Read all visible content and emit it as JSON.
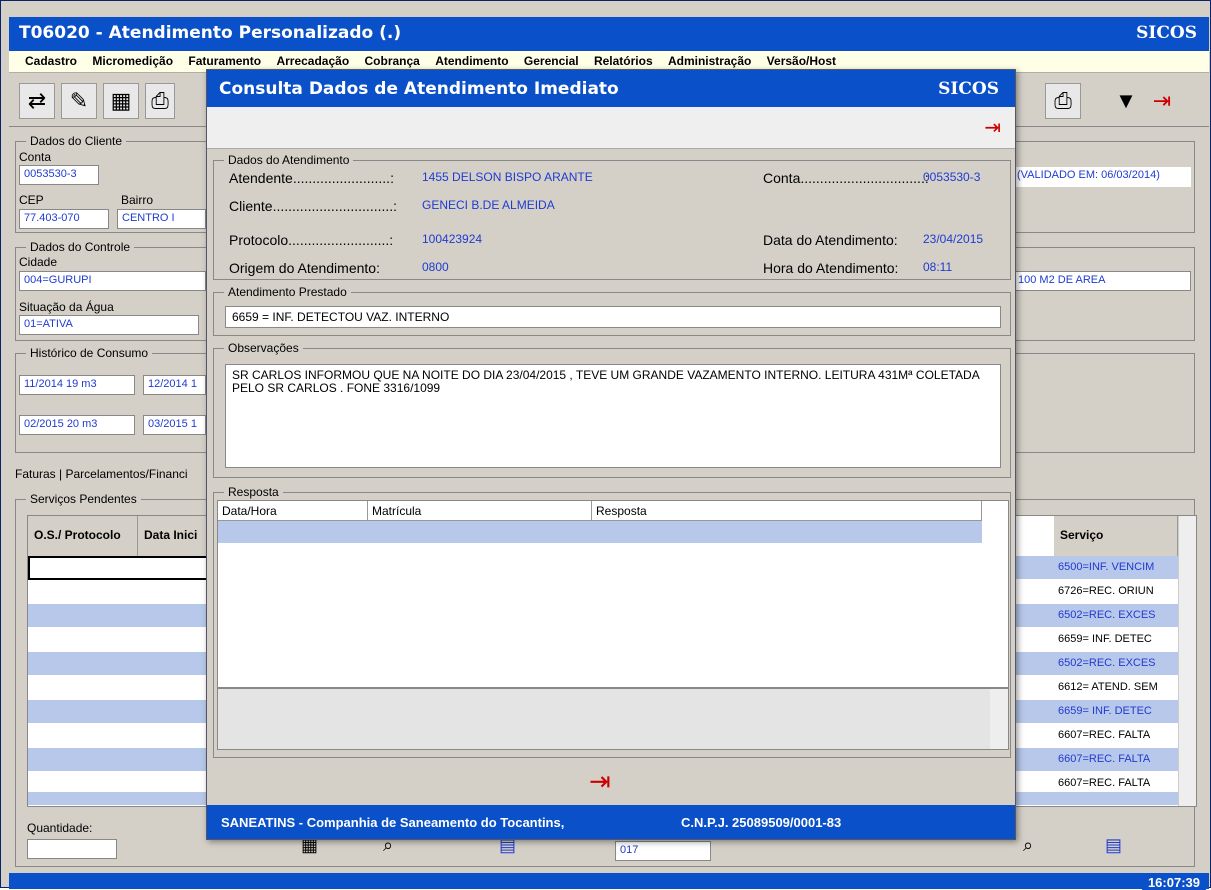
{
  "window": {
    "title": "T06020 - Atendimento Personalizado    (.)",
    "brand": "SICOS",
    "menu": [
      "Cadastro",
      "Micromedição",
      "Faturamento",
      "Arrecadação",
      "Cobrança",
      "Atendimento",
      "Gerencial",
      "Relatórios",
      "Administração",
      "Versão/Host"
    ],
    "clock": "16:07:39"
  },
  "cliente": {
    "legend": "Dados do Cliente",
    "conta_label": "Conta",
    "conta": "0053530-3",
    "cep_label": "CEP",
    "cep": "77.403-070",
    "bairro_label": "Bairro",
    "bairro": "CENTRO I",
    "validado": "(VALIDADO EM: 06/03/2014)"
  },
  "controle": {
    "legend": "Dados do Controle",
    "cidade_label": "Cidade",
    "cidade": "004=GURUPI",
    "area": "100 M2 DE AREA",
    "situacao_label": "Situação da Água",
    "situacao": "01=ATIVA"
  },
  "historico": {
    "legend": "Histórico de Consumo",
    "items": [
      "11/2014 19 m3",
      "12/2014 1",
      "02/2015 20 m3",
      "03/2015 1"
    ]
  },
  "tabs": {
    "faturas": "Faturas",
    "parcelamentos": "Parcelamentos/Financi"
  },
  "servicos": {
    "legend": "Serviços Pendentes",
    "col1": "O.S./ Protocolo",
    "col2": "Data Inici",
    "col3": "Serviço",
    "rows": [
      "6500=INF. VENCIM",
      "6726=REC. ORIUN",
      "6502=REC. EXCES",
      "6659= INF. DETEC",
      "6502=REC. EXCES",
      "6612= ATEND. SEM",
      "6659= INF. DETEC",
      "6607=REC. FALTA",
      "6607=REC. FALTA",
      "6607=REC. FALTA"
    ],
    "quantidade_label": "Quantidade:",
    "count": "017"
  },
  "modal": {
    "title": "Consulta Dados de Atendimento Imediato",
    "brand": "SICOS",
    "dados_legend": "Dados do Atendimento",
    "atendente_label": "Atendente.........................:",
    "atendente": "1455   DELSON BISPO ARANTE",
    "conta_label": "Conta................................:",
    "conta": "0053530-3",
    "cliente_label": "Cliente...............................:",
    "cliente": "GENECI B.DE ALMEIDA",
    "protocolo_label": "Protocolo..........................:",
    "protocolo": "100423924",
    "data_label": "Data do Atendimento:",
    "data": "23/04/2015",
    "origem_label": "Origem do Atendimento:",
    "origem": "0800",
    "hora_label": "Hora do Atendimento:",
    "hora": "08:11",
    "prestado_legend": "Atendimento Prestado",
    "prestado": "6659 = INF. DETECTOU VAZ. INTERNO",
    "obs_legend": "Observações",
    "obs": "SR  CARLOS    INFORMOU QUE NA NOITE DO DIA 23/04/2015 , TEVE UM GRANDE VAZAMENTO INTERNO. LEITURA  431Mª COLETADA PELO SR  CARLOS   .  FONE   3316/1099",
    "resposta_legend": "Resposta",
    "col_datahora": "Data/Hora",
    "col_matricula": "Matrícula",
    "col_resposta": "Resposta",
    "footer_company": "SANEATINS - Companhia de Saneamento do Tocantins,",
    "footer_cnpj": "C.N.P.J. 25089509/0001-83"
  },
  "colors": {
    "title_bar": "#0a50c8",
    "row_alt": "#b7c8ea",
    "value_text": "#1f3bd1"
  }
}
